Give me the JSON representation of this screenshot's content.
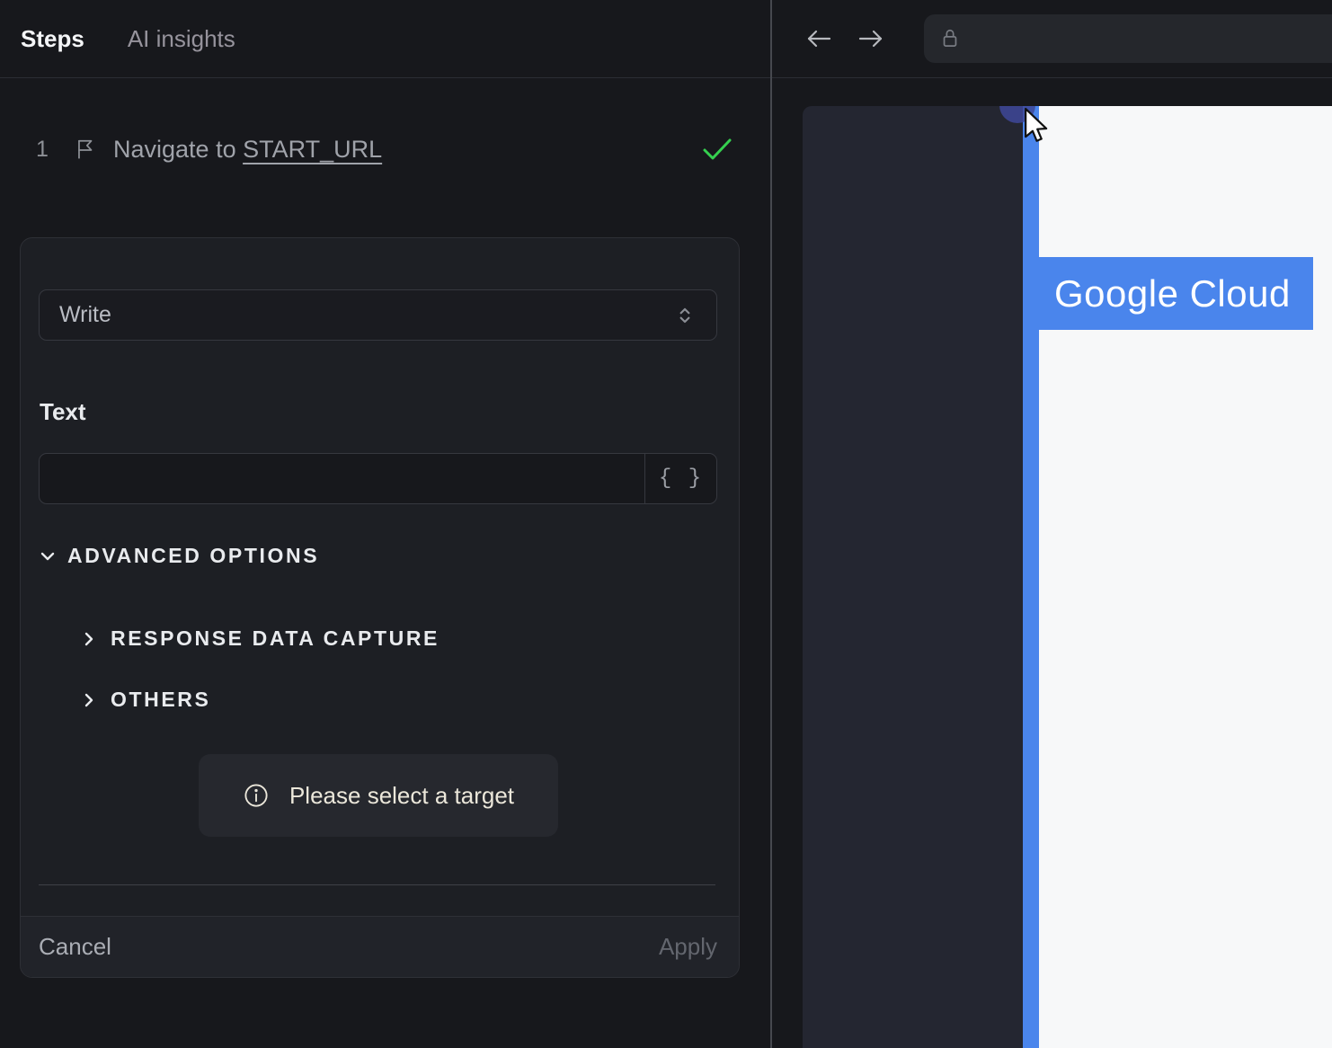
{
  "left_panel": {
    "tabs": [
      {
        "label": "Steps",
        "active": true
      },
      {
        "label": "AI insights",
        "active": false
      }
    ],
    "step": {
      "index": "1",
      "text": "Navigate to ",
      "link": "START_URL",
      "status": "completed"
    },
    "editor": {
      "action_select": {
        "value": "Write"
      },
      "text_field": {
        "label": "Text",
        "value": "",
        "variable_button_label": "{ }"
      },
      "advanced_options": {
        "label": "ADVANCED OPTIONS",
        "expanded": true
      },
      "sections": [
        {
          "label": "RESPONSE DATA CAPTURE",
          "expanded": false
        },
        {
          "label": "OTHERS",
          "expanded": false
        }
      ],
      "toast": {
        "message": "Please select a target"
      },
      "footer": {
        "cancel_label": "Cancel",
        "apply_label": "Apply",
        "apply_enabled": false
      }
    }
  },
  "right_panel": {
    "browser": {
      "url_value": ""
    },
    "page": {
      "logo_text": "Google Cloud"
    }
  },
  "icons": [
    "flag-icon",
    "check-icon",
    "chevron-updown-icon",
    "chevron-down-icon",
    "chevron-right-icon",
    "braces-icon",
    "info-icon",
    "back-arrow-icon",
    "forward-arrow-icon",
    "lock-icon",
    "cursor-icon",
    "target-dot"
  ],
  "colors": {
    "panel_bg": "#17181c",
    "card_bg": "#1d1f24",
    "accent_blue": "#4a85ec",
    "success_green": "#35d04f",
    "toast_text": "#ebe7da",
    "viewport_dark": "#242631",
    "page_white": "#f7f8f9",
    "target_dot_indigo": "#3e4899"
  }
}
